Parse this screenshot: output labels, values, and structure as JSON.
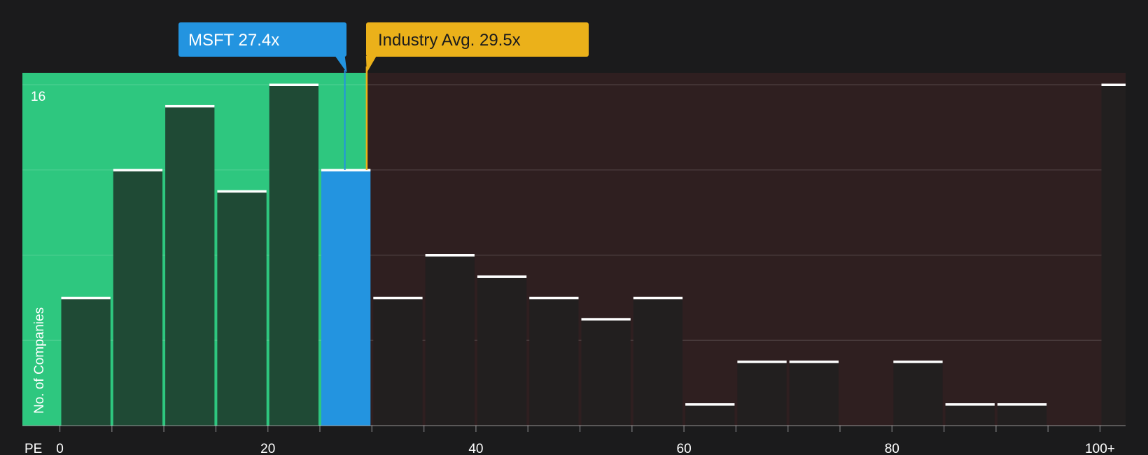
{
  "chart_data": {
    "type": "bar",
    "x_axis_title": "PE",
    "y_axis_title": "No. of Companies",
    "y_max_label": "16",
    "ylim": [
      0,
      16.6
    ],
    "x_ticks": [
      {
        "value": 0,
        "label": "0"
      },
      {
        "value": 20,
        "label": "20"
      },
      {
        "value": 40,
        "label": "40"
      },
      {
        "value": 60,
        "label": "60"
      },
      {
        "value": 80,
        "label": "80"
      },
      {
        "value": 100,
        "label": "100+"
      }
    ],
    "bins": [
      {
        "x0": 0,
        "x1": 5,
        "count": 6
      },
      {
        "x0": 5,
        "x1": 10,
        "count": 12
      },
      {
        "x0": 10,
        "x1": 15,
        "count": 15
      },
      {
        "x0": 15,
        "x1": 20,
        "count": 11
      },
      {
        "x0": 20,
        "x1": 25,
        "count": 16
      },
      {
        "x0": 25,
        "x1": 30,
        "count": 12,
        "highlight": true
      },
      {
        "x0": 30,
        "x1": 35,
        "count": 6
      },
      {
        "x0": 35,
        "x1": 40,
        "count": 8
      },
      {
        "x0": 40,
        "x1": 45,
        "count": 7
      },
      {
        "x0": 45,
        "x1": 50,
        "count": 6
      },
      {
        "x0": 50,
        "x1": 55,
        "count": 5
      },
      {
        "x0": 55,
        "x1": 60,
        "count": 6
      },
      {
        "x0": 60,
        "x1": 65,
        "count": 1
      },
      {
        "x0": 65,
        "x1": 70,
        "count": 3
      },
      {
        "x0": 70,
        "x1": 75,
        "count": 3
      },
      {
        "x0": 75,
        "x1": 80,
        "count": 0
      },
      {
        "x0": 80,
        "x1": 85,
        "count": 3
      },
      {
        "x0": 85,
        "x1": 90,
        "count": 1
      },
      {
        "x0": 90,
        "x1": 95,
        "count": 1
      },
      {
        "x0": 95,
        "x1": 100,
        "count": 0
      },
      {
        "x0": 100,
        "x1": 102.5,
        "count": 16,
        "overflow": true
      }
    ],
    "company": {
      "label": "MSFT 27.4x",
      "value": 27.4
    },
    "industry": {
      "label": "Industry Avg. 29.5x",
      "value": 29.5
    },
    "colors": {
      "background": "#1b1b1c",
      "green_region": "#2ec77f",
      "red_region": "#2f1f20",
      "bar_in_green": "#1f4a35",
      "bar_in_red": "#221f1f",
      "highlight_bar": "#2394e0",
      "company_callout": "#2394e0",
      "industry_callout": "#ebb11a",
      "bar_cap": "#ffffff",
      "industry_text": "#1b1b1c",
      "company_text": "#ffffff"
    }
  }
}
